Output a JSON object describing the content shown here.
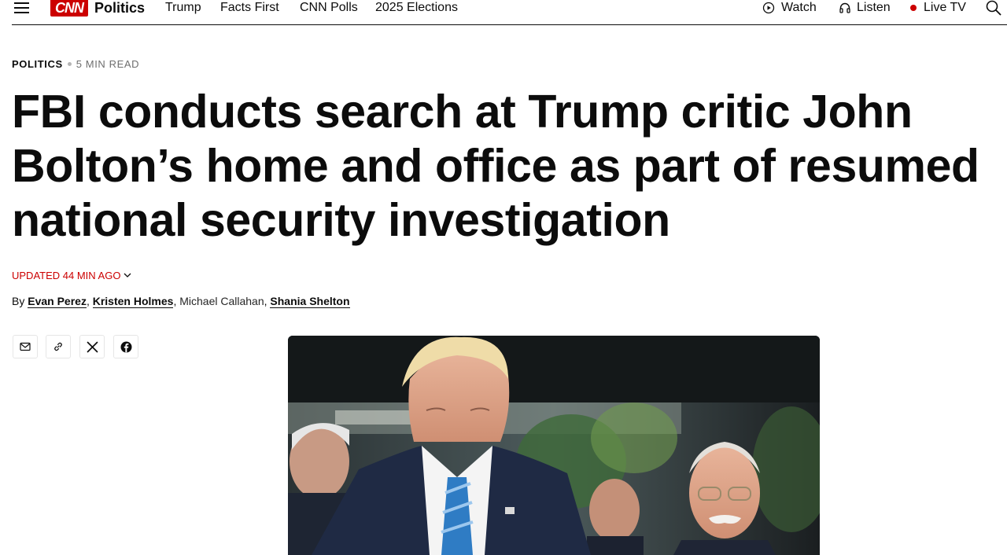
{
  "header": {
    "logo_text": "CNN",
    "section": "Politics",
    "nav": [
      "Trump",
      "Facts First",
      "CNN Polls",
      "2025 Elections"
    ],
    "watch": "Watch",
    "listen": "Listen",
    "live_tv": "Live TV",
    "accent_color": "#cc0000"
  },
  "article": {
    "category": "POLITICS",
    "read_time": "5 MIN READ",
    "headline": "FBI conducts search at Trump critic John Bolton’s home and office as part of resumed national security investigation",
    "updated": "UPDATED 44 MIN AGO",
    "byline": {
      "prefix": "By ",
      "authors": [
        "Evan Perez",
        "Kristen Holmes",
        "Michael Callahan",
        "Shania Shelton"
      ],
      "separator": ", "
    }
  },
  "share_icons": [
    "mail-icon",
    "link-icon",
    "x-icon",
    "facebook-icon"
  ]
}
